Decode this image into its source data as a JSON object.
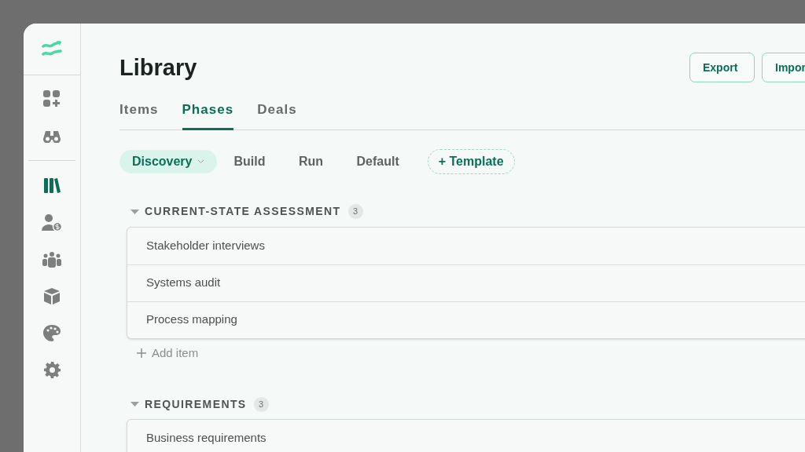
{
  "sidebar": {
    "items": [
      {
        "selected": false
      },
      {
        "selected": false
      },
      {
        "selected": true
      },
      {
        "selected": false
      },
      {
        "selected": false
      },
      {
        "selected": false
      },
      {
        "selected": false
      },
      {
        "selected": false
      }
    ]
  },
  "header": {
    "title": "Library",
    "buttons": [
      "Export",
      "Impor"
    ]
  },
  "tabs": [
    {
      "label": "Items",
      "selected": false
    },
    {
      "label": "Phases",
      "selected": true
    },
    {
      "label": "Deals",
      "selected": false
    }
  ],
  "phases": [
    {
      "label": "Discovery",
      "selected": true
    },
    {
      "label": "Build",
      "selected": false
    },
    {
      "label": "Run",
      "selected": false
    },
    {
      "label": "Default",
      "selected": false
    }
  ],
  "template_button": "+ Template",
  "sections": [
    {
      "title": "CURRENT-STATE ASSESSMENT",
      "count": "3",
      "expanded": true,
      "items": [
        "Stakeholder interviews",
        "Systems audit",
        "Process mapping"
      ],
      "add_item": "Add item"
    },
    {
      "title": "REQUIREMENTS",
      "count": "3",
      "expanded": true,
      "items": [
        "Business requirements"
      ]
    }
  ]
}
